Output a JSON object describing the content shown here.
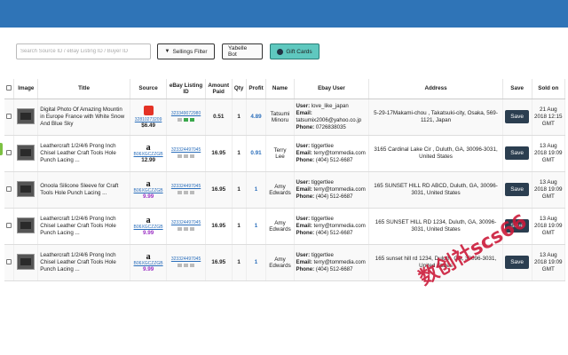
{
  "toolbar": {
    "search_placeholder": "Search Source ID / eBay Listing ID / Buyer ID",
    "filter_label": "Sellings Filter",
    "yabelle_label": "Yabelle Bot",
    "gift_label": "Gift Cards"
  },
  "table": {
    "headers": [
      "Image",
      "Title",
      "Source",
      "eBay Listing ID",
      "Amount Paid",
      "Qty",
      "Profit",
      "Name",
      "Ebay User",
      "Address",
      "Save",
      "Sold on"
    ],
    "user_label": "User:",
    "email_label": "Email:",
    "phone_label": "Phone:",
    "save_label": "Save",
    "rows": [
      {
        "title": "Digital Photo Of Amazing Mountin in Europe France with White Snow And Blue Sky",
        "source_logo": "aliexpress-icon",
        "source_id": "32810273209",
        "source_price": "$6.49",
        "ebay_id": "323349072980",
        "amount": "0.51",
        "qty": "1",
        "profit": "4.89",
        "name": "Tatsumi Minoru",
        "user": "love_like_japan",
        "email": "tatsumix2006@yahoo.co.jp",
        "phone": "0726838035",
        "address": "5-29-17Makami-chou , Takatsuki-city, Osaka, 569-1121, Japan",
        "sold": "21 Aug 2018 12:15 GMT"
      },
      {
        "title": "Leathercraft 1/2/4/6 Prong Inch Chisel Leather Craft Tools Hole Punch Lacing ...",
        "source_logo": "amazon-icon",
        "source_id": "B06XGCZZGB",
        "source_price": "12.99",
        "ebay_id": "323324497045",
        "amount": "16.95",
        "qty": "1",
        "profit": "0.91",
        "name": "Terry Lee",
        "user": "tiggertlee",
        "email": "terry@tommedia.com",
        "phone": "(404) 512-6687",
        "address": "3165 Cardinal Lake Cir , Duluth, GA, 30096-3031, United States",
        "sold": "13 Aug 2018 19:09 GMT"
      },
      {
        "title": "Onoola Silicone Sleeve for Craft Tools Hole Punch Lacing ...",
        "source_logo": "amazon-icon",
        "source_id": "B06XGCZZGB",
        "source_price": "9.99",
        "ebay_id": "323324497045",
        "amount": "16.95",
        "qty": "1",
        "profit": "1",
        "name": "Amy Edwards",
        "user": "tiggertlee",
        "email": "terry@tommedia.com",
        "phone": "(404) 512-6687",
        "address": "165 SUNSET HILL RD ABCD, Duluth, GA, 30096-3031, United States",
        "sold": "13 Aug 2018 19:09 GMT"
      },
      {
        "title": "Leathercraft 1/2/4/6 Prong Inch Chisel Leather Craft Tools Hole Punch Lacing ...",
        "source_logo": "amazon-icon",
        "source_id": "B06XGCZZGB",
        "source_price": "9.99",
        "ebay_id": "323324497045",
        "amount": "16.95",
        "qty": "1",
        "profit": "1",
        "name": "Amy Edwards",
        "user": "tiggertlee",
        "email": "terry@tommedia.com",
        "phone": "(404) 512-6687",
        "address": "165 SUNSET HILL RD 1234, Duluth, GA, 30096-3031, United States",
        "sold": "13 Aug 2018 19:09 GMT"
      },
      {
        "title": "Leathercraft 1/2/4/6 Prong Inch Chisel Leather Craft Tools Hole Punch Lacing ...",
        "source_logo": "amazon-icon",
        "source_id": "B06XGCZZGB",
        "source_price": "9.99",
        "ebay_id": "323324497045",
        "amount": "16.95",
        "qty": "1",
        "profit": "1",
        "name": "Amy Edwards",
        "user": "tiggertlee",
        "email": "terry@tommedia.com",
        "phone": "(404) 512-6687",
        "address": "165 sunset hill rd 1234, Duluth, GA, 30096-3031, United States",
        "sold": "13 Aug 2018 19:09 GMT"
      }
    ]
  },
  "watermark": "数创社scs66",
  "colors": {
    "topbar": "#2f74b7",
    "gift_button": "#5fc8bf",
    "save_button": "#2b3e50",
    "link": "#2a6ebb",
    "watermark": "#cc1b3a"
  }
}
